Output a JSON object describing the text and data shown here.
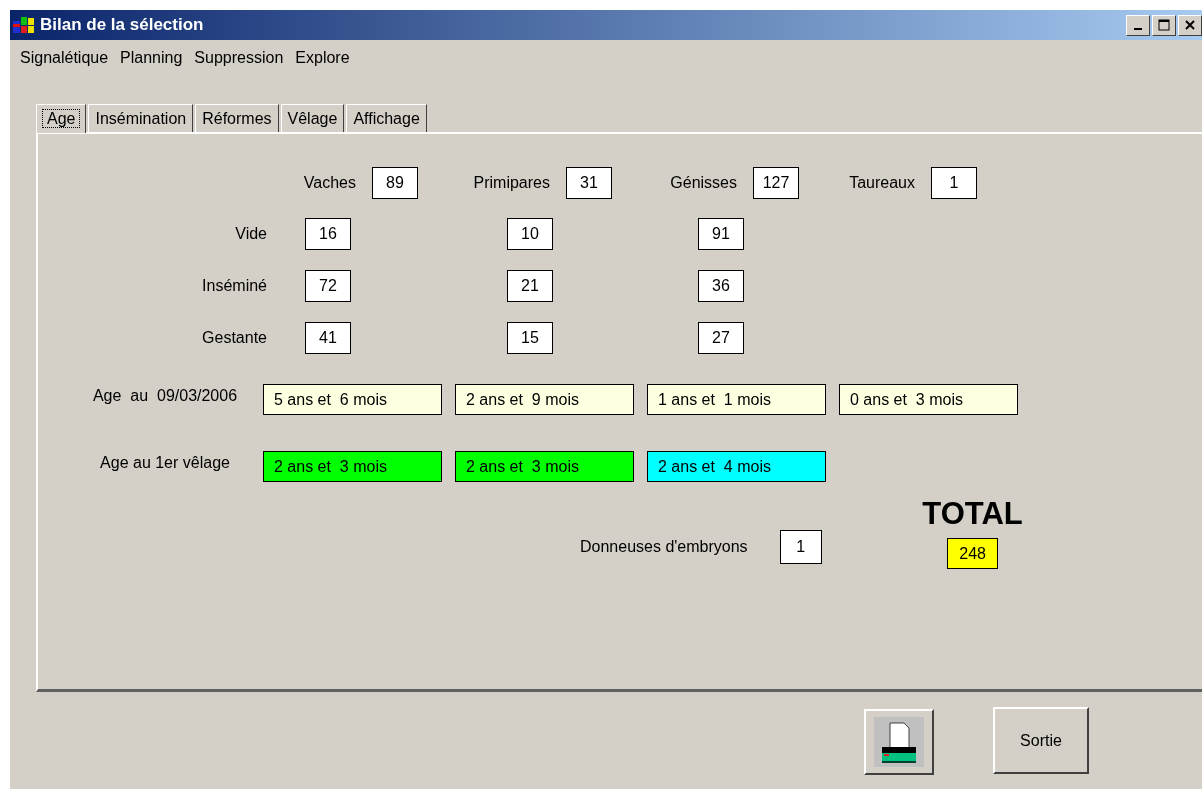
{
  "window": {
    "title": "Bilan de la sélection"
  },
  "menu": [
    {
      "label": "Signalétique"
    },
    {
      "label": "Planning"
    },
    {
      "label": "Suppression"
    },
    {
      "label": "Explore"
    }
  ],
  "tabs": [
    {
      "label": "Age",
      "selected": true
    },
    {
      "label": "Insémination",
      "selected": false
    },
    {
      "label": "Réformes",
      "selected": false
    },
    {
      "label": "Vêlage",
      "selected": false
    },
    {
      "label": "Affichage",
      "selected": false
    }
  ],
  "categories": [
    {
      "label": "Vaches",
      "value": "89"
    },
    {
      "label": "Primipares",
      "value": "31"
    },
    {
      "label": "Génisses",
      "value": "127"
    },
    {
      "label": "Taureaux",
      "value": "1"
    }
  ],
  "status_rows": [
    {
      "label": "Vide",
      "values": [
        "16",
        "10",
        "91"
      ]
    },
    {
      "label": "Inséminé",
      "values": [
        "72",
        "21",
        "36"
      ]
    },
    {
      "label": "Gestante",
      "values": [
        "41",
        "15",
        "27"
      ]
    }
  ],
  "age_rows": [
    {
      "label": "Age  au  09/03/2006",
      "values": [
        {
          "text": "5 ans et  6 mois",
          "color": "#ffffe1"
        },
        {
          "text": "2 ans et  9 mois",
          "color": "#ffffe1"
        },
        {
          "text": "1 ans et  1 mois",
          "color": "#ffffe1"
        },
        {
          "text": "0 ans et  3 mois",
          "color": "#ffffe1"
        }
      ]
    },
    {
      "label": "Age au 1er vêlage",
      "values": [
        {
          "text": "2 ans et  3 mois",
          "color": "#00ff00"
        },
        {
          "text": "2 ans et  3 mois",
          "color": "#00ff00"
        },
        {
          "text": "2 ans et  4 mois",
          "color": "#00ffff"
        }
      ]
    }
  ],
  "donors": {
    "label": "Donneuses d'embryons",
    "value": "1"
  },
  "total": {
    "label": "TOTAL",
    "value": "248"
  },
  "buttons": [
    {
      "kind": "print"
    },
    {
      "kind": "text",
      "label": "Sortie"
    }
  ]
}
